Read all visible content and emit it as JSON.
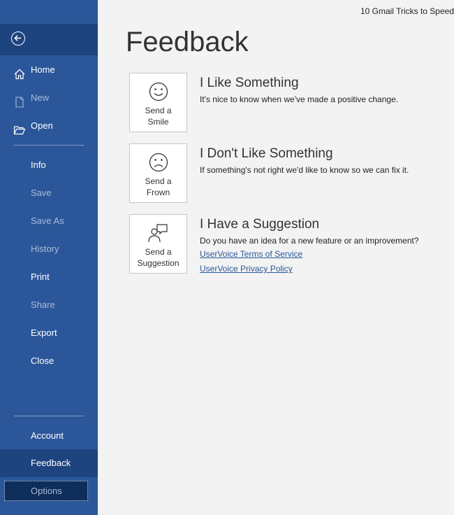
{
  "window": {
    "doc_title": "10 Gmail Tricks to Speed"
  },
  "sidebar": {
    "back_label": "Back",
    "items": [
      {
        "label": "Home"
      },
      {
        "label": "New"
      },
      {
        "label": "Open"
      },
      {
        "label": "Info"
      },
      {
        "label": "Save"
      },
      {
        "label": "Save As"
      },
      {
        "label": "History"
      },
      {
        "label": "Print"
      },
      {
        "label": "Share"
      },
      {
        "label": "Export"
      },
      {
        "label": "Close"
      },
      {
        "label": "Account"
      },
      {
        "label": "Feedback"
      },
      {
        "label": "Options"
      }
    ]
  },
  "main": {
    "title": "Feedback",
    "cards": [
      {
        "button_label_1": "Send a",
        "button_label_2": "Smile",
        "heading": "I Like Something",
        "description": "It's nice to know when we've made a positive change."
      },
      {
        "button_label_1": "Send a",
        "button_label_2": "Frown",
        "heading": "I Don't Like Something",
        "description": "If something's not right we'd like to know so we can fix it."
      },
      {
        "button_label_1": "Send a",
        "button_label_2": "Suggestion",
        "heading": "I Have a Suggestion",
        "description": "Do you have an idea for a new feature or an improvement?",
        "links": [
          "UserVoice Terms of Service",
          "UserVoice Privacy Policy"
        ]
      }
    ]
  },
  "colors": {
    "sidebar": "#2b579a",
    "sidebar_selected": "#1e4480",
    "background": "#f3f3f3",
    "link": "#2b579a"
  }
}
